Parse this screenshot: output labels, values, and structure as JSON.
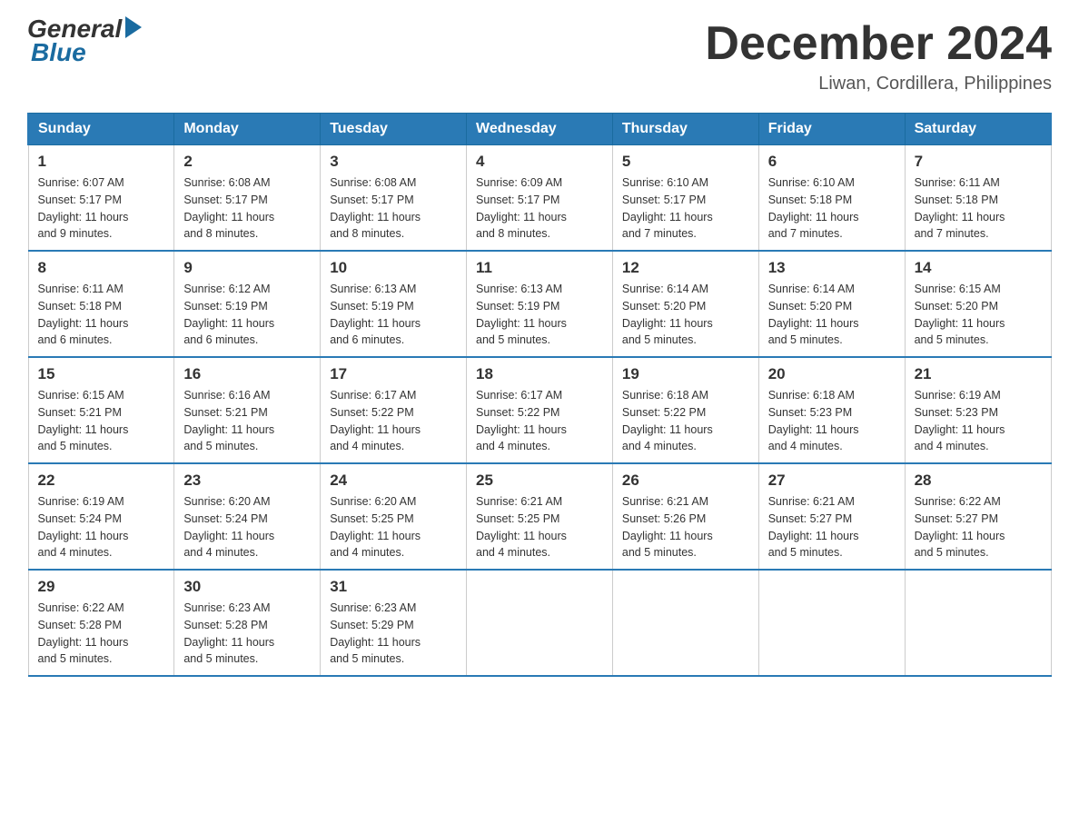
{
  "header": {
    "logo_general": "General",
    "logo_blue": "Blue",
    "month_year": "December 2024",
    "location": "Liwan, Cordillera, Philippines"
  },
  "days_of_week": [
    "Sunday",
    "Monday",
    "Tuesday",
    "Wednesday",
    "Thursday",
    "Friday",
    "Saturday"
  ],
  "weeks": [
    [
      {
        "day": "1",
        "sunrise": "6:07 AM",
        "sunset": "5:17 PM",
        "daylight": "11 hours and 9 minutes."
      },
      {
        "day": "2",
        "sunrise": "6:08 AM",
        "sunset": "5:17 PM",
        "daylight": "11 hours and 8 minutes."
      },
      {
        "day": "3",
        "sunrise": "6:08 AM",
        "sunset": "5:17 PM",
        "daylight": "11 hours and 8 minutes."
      },
      {
        "day": "4",
        "sunrise": "6:09 AM",
        "sunset": "5:17 PM",
        "daylight": "11 hours and 8 minutes."
      },
      {
        "day": "5",
        "sunrise": "6:10 AM",
        "sunset": "5:17 PM",
        "daylight": "11 hours and 7 minutes."
      },
      {
        "day": "6",
        "sunrise": "6:10 AM",
        "sunset": "5:18 PM",
        "daylight": "11 hours and 7 minutes."
      },
      {
        "day": "7",
        "sunrise": "6:11 AM",
        "sunset": "5:18 PM",
        "daylight": "11 hours and 7 minutes."
      }
    ],
    [
      {
        "day": "8",
        "sunrise": "6:11 AM",
        "sunset": "5:18 PM",
        "daylight": "11 hours and 6 minutes."
      },
      {
        "day": "9",
        "sunrise": "6:12 AM",
        "sunset": "5:19 PM",
        "daylight": "11 hours and 6 minutes."
      },
      {
        "day": "10",
        "sunrise": "6:13 AM",
        "sunset": "5:19 PM",
        "daylight": "11 hours and 6 minutes."
      },
      {
        "day": "11",
        "sunrise": "6:13 AM",
        "sunset": "5:19 PM",
        "daylight": "11 hours and 5 minutes."
      },
      {
        "day": "12",
        "sunrise": "6:14 AM",
        "sunset": "5:20 PM",
        "daylight": "11 hours and 5 minutes."
      },
      {
        "day": "13",
        "sunrise": "6:14 AM",
        "sunset": "5:20 PM",
        "daylight": "11 hours and 5 minutes."
      },
      {
        "day": "14",
        "sunrise": "6:15 AM",
        "sunset": "5:20 PM",
        "daylight": "11 hours and 5 minutes."
      }
    ],
    [
      {
        "day": "15",
        "sunrise": "6:15 AM",
        "sunset": "5:21 PM",
        "daylight": "11 hours and 5 minutes."
      },
      {
        "day": "16",
        "sunrise": "6:16 AM",
        "sunset": "5:21 PM",
        "daylight": "11 hours and 5 minutes."
      },
      {
        "day": "17",
        "sunrise": "6:17 AM",
        "sunset": "5:22 PM",
        "daylight": "11 hours and 4 minutes."
      },
      {
        "day": "18",
        "sunrise": "6:17 AM",
        "sunset": "5:22 PM",
        "daylight": "11 hours and 4 minutes."
      },
      {
        "day": "19",
        "sunrise": "6:18 AM",
        "sunset": "5:22 PM",
        "daylight": "11 hours and 4 minutes."
      },
      {
        "day": "20",
        "sunrise": "6:18 AM",
        "sunset": "5:23 PM",
        "daylight": "11 hours and 4 minutes."
      },
      {
        "day": "21",
        "sunrise": "6:19 AM",
        "sunset": "5:23 PM",
        "daylight": "11 hours and 4 minutes."
      }
    ],
    [
      {
        "day": "22",
        "sunrise": "6:19 AM",
        "sunset": "5:24 PM",
        "daylight": "11 hours and 4 minutes."
      },
      {
        "day": "23",
        "sunrise": "6:20 AM",
        "sunset": "5:24 PM",
        "daylight": "11 hours and 4 minutes."
      },
      {
        "day": "24",
        "sunrise": "6:20 AM",
        "sunset": "5:25 PM",
        "daylight": "11 hours and 4 minutes."
      },
      {
        "day": "25",
        "sunrise": "6:21 AM",
        "sunset": "5:25 PM",
        "daylight": "11 hours and 4 minutes."
      },
      {
        "day": "26",
        "sunrise": "6:21 AM",
        "sunset": "5:26 PM",
        "daylight": "11 hours and 5 minutes."
      },
      {
        "day": "27",
        "sunrise": "6:21 AM",
        "sunset": "5:27 PM",
        "daylight": "11 hours and 5 minutes."
      },
      {
        "day": "28",
        "sunrise": "6:22 AM",
        "sunset": "5:27 PM",
        "daylight": "11 hours and 5 minutes."
      }
    ],
    [
      {
        "day": "29",
        "sunrise": "6:22 AM",
        "sunset": "5:28 PM",
        "daylight": "11 hours and 5 minutes."
      },
      {
        "day": "30",
        "sunrise": "6:23 AM",
        "sunset": "5:28 PM",
        "daylight": "11 hours and 5 minutes."
      },
      {
        "day": "31",
        "sunrise": "6:23 AM",
        "sunset": "5:29 PM",
        "daylight": "11 hours and 5 minutes."
      },
      null,
      null,
      null,
      null
    ]
  ],
  "labels": {
    "sunrise": "Sunrise:",
    "sunset": "Sunset:",
    "daylight": "Daylight:"
  }
}
